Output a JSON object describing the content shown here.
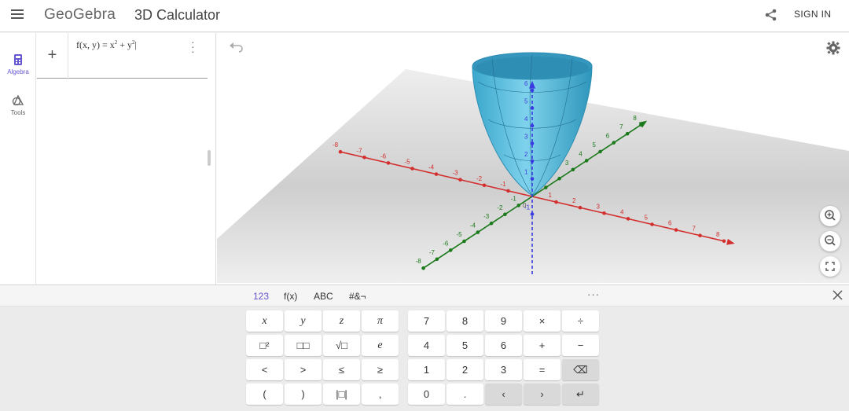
{
  "header": {
    "logo_text": "GeoGebra",
    "app_title": "3D Calculator",
    "share_icon": "share-icon",
    "signin_label": "SIGN IN"
  },
  "rail": {
    "items": [
      {
        "label": "Algebra",
        "icon": "calculator-icon",
        "active": true
      },
      {
        "label": "Tools",
        "icon": "tools-icon",
        "active": false
      }
    ]
  },
  "algebra": {
    "expression_prefix": "f(x, y) = x",
    "expression_mid": " + y",
    "exponent": "2"
  },
  "graph": {
    "x_axis_color": "#d32f2f",
    "y_axis_color": "#1b7a1b",
    "z_axis_color": "#3a3ae0",
    "surface_color": "#46b4d8",
    "x_ticks": [
      "-8",
      "-7",
      "-6",
      "-5",
      "-4",
      "-3",
      "-2",
      "-1",
      "0",
      "1",
      "2",
      "3",
      "4",
      "5",
      "6",
      "7",
      "8"
    ],
    "y_ticks": [
      "-8",
      "-7",
      "-6",
      "-5",
      "-4",
      "-3",
      "-2",
      "-1",
      "1",
      "2",
      "3",
      "4",
      "5",
      "6",
      "7",
      "8"
    ],
    "z_ticks": [
      "-1",
      "1",
      "2",
      "3",
      "4",
      "5",
      "6"
    ]
  },
  "keyboard": {
    "tabs": [
      "123",
      "f(x)",
      "ABC",
      "#&¬"
    ],
    "more_label": "···",
    "rows": [
      [
        "x",
        "y",
        "z",
        "π",
        "7",
        "8",
        "9",
        "×",
        "÷"
      ],
      [
        "□²",
        "□□",
        "√□",
        "e",
        "4",
        "5",
        "6",
        "+",
        "−"
      ],
      [
        "<",
        ">",
        "≤",
        "≥",
        "1",
        "2",
        "3",
        "=",
        "⌫"
      ],
      [
        "(",
        ")",
        "|□|",
        ",",
        "0",
        ".",
        "‹",
        "›",
        "↵"
      ]
    ]
  }
}
